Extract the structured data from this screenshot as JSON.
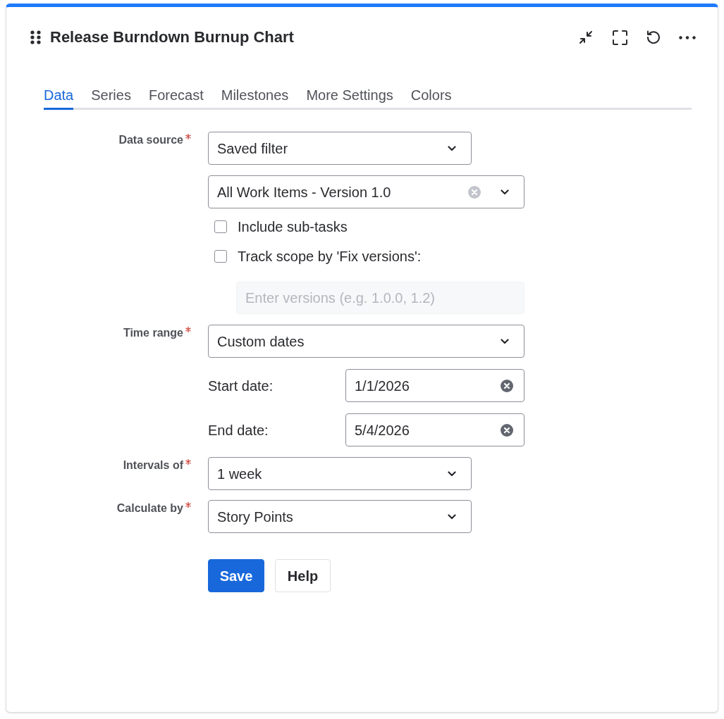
{
  "panel": {
    "title": "Release Burndown Burnup Chart"
  },
  "tabs": [
    {
      "label": "Data",
      "selected": true
    },
    {
      "label": "Series",
      "selected": false
    },
    {
      "label": "Forecast",
      "selected": false
    },
    {
      "label": "Milestones",
      "selected": false
    },
    {
      "label": "More Settings",
      "selected": false
    },
    {
      "label": "Colors",
      "selected": false
    }
  ],
  "data_source": {
    "label": "Data source",
    "required": true,
    "source_select": {
      "value": "Saved filter"
    },
    "filter_select": {
      "value": "All Work Items - Version 1.0"
    },
    "options": [
      {
        "label": "Include sub-tasks",
        "checked": false
      },
      {
        "label": "Track scope by 'Fix versions':",
        "checked": false
      }
    ],
    "versions_input": {
      "placeholder": "Enter versions (e.g. 1.0.0, 1.2)",
      "disabled": true
    }
  },
  "time_range": {
    "label": "Time range",
    "required": true,
    "select": {
      "value": "Custom dates"
    },
    "dates": [
      {
        "label": "Start date:",
        "value": "1/1/2026"
      },
      {
        "label": "End date:",
        "value": "5/4/2026"
      }
    ]
  },
  "intervals": {
    "label": "Intervals of",
    "required": true,
    "select": {
      "value": "1 week"
    }
  },
  "calculate_by": {
    "label": "Calculate by",
    "required": true,
    "select": {
      "value": "Story Points"
    }
  },
  "buttons": [
    {
      "label": "Save",
      "kind": "primary"
    },
    {
      "label": "Help",
      "kind": "secondary"
    }
  ]
}
